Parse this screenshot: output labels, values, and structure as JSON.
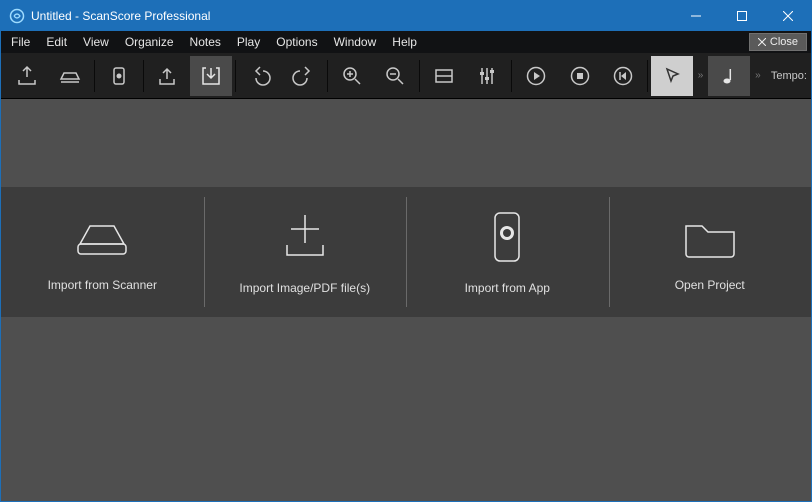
{
  "titlebar": {
    "title": "Untitled - ScanScore Professional"
  },
  "menu": {
    "file": "File",
    "edit": "Edit",
    "view": "View",
    "organize": "Organize",
    "notes": "Notes",
    "play": "Play",
    "options": "Options",
    "window": "Window",
    "help": "Help",
    "close_panel": "Close"
  },
  "toolbar": {
    "tempo_label": "Tempo:"
  },
  "start": {
    "scanner": "Import from Scanner",
    "image": "Import Image/PDF file(s)",
    "app": "Import from App",
    "open": "Open Project"
  }
}
